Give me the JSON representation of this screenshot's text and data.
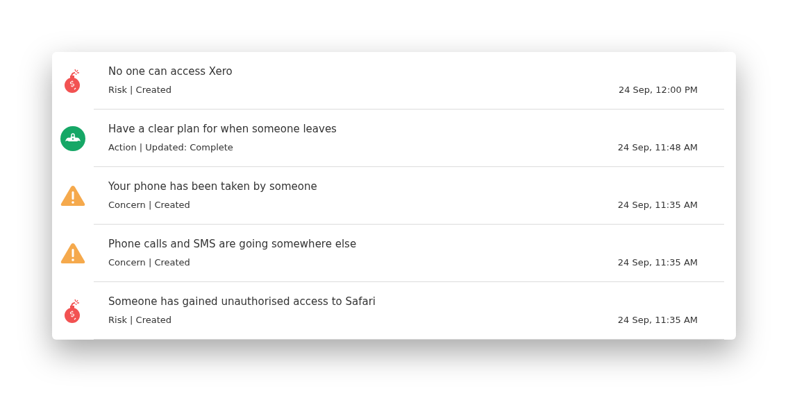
{
  "items": [
    {
      "kind": "risk",
      "title": "No one can access Xero",
      "meta": "Risk | Created",
      "time": "24 Sep, 12:00 PM"
    },
    {
      "kind": "action",
      "title": "Have a clear plan for when someone leaves",
      "meta": "Action | Updated: Complete",
      "time": "24 Sep, 11:48 AM"
    },
    {
      "kind": "concern",
      "title": "Your phone has been taken by someone",
      "meta": "Concern | Created",
      "time": "24 Sep, 11:35 AM"
    },
    {
      "kind": "concern",
      "title": "Phone calls and SMS are going somewhere else",
      "meta": "Concern | Created",
      "time": "24 Sep, 11:35 AM"
    },
    {
      "kind": "risk",
      "title": "Someone has gained unauthorised access to Safari",
      "meta": "Risk | Created",
      "time": "24 Sep, 11:35 AM"
    }
  ]
}
